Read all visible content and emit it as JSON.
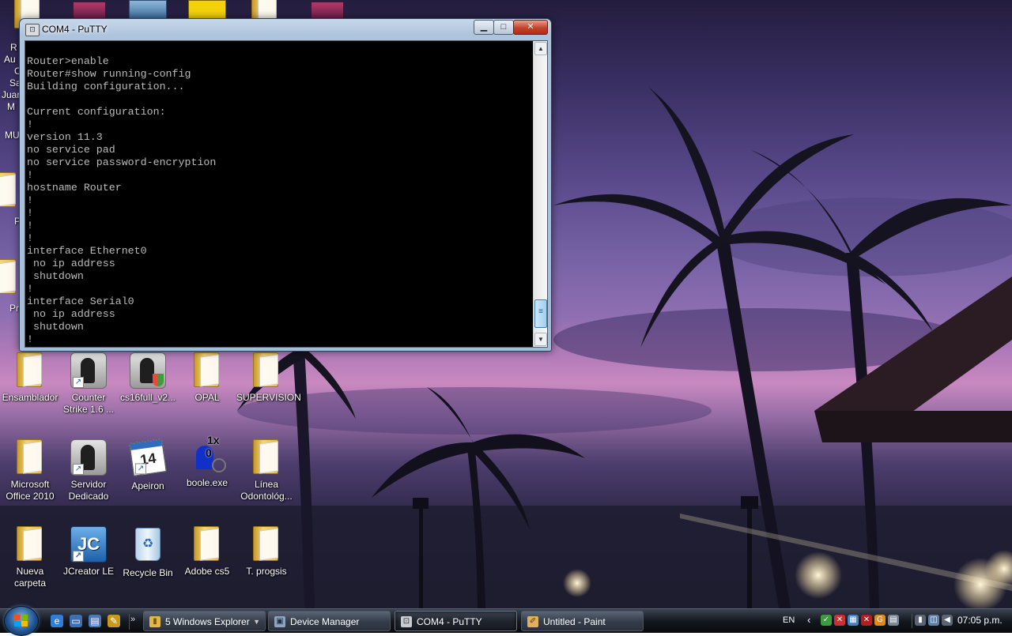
{
  "desktop": {
    "icons": [
      {
        "label": "Ensamblador",
        "type": "folder"
      },
      {
        "label": "Counter Strike 1.6 ...",
        "type": "counter-strike-shortcut"
      },
      {
        "label": "cs16full_v2...",
        "type": "counter-strike-installer"
      },
      {
        "label": "OPAL",
        "type": "folder"
      },
      {
        "label": "SUPERVISION",
        "type": "folder"
      },
      {
        "label": "Microsoft Office 2010",
        "type": "folder"
      },
      {
        "label": "Servidor Dedicado",
        "type": "counter-strike-shortcut"
      },
      {
        "label": "Apeiron",
        "type": "calendar-shortcut"
      },
      {
        "label": "boole.exe",
        "type": "boole-app"
      },
      {
        "label": "Línea Odontológ...",
        "type": "folder"
      },
      {
        "label": "Nueva carpeta",
        "type": "folder"
      },
      {
        "label": "JCreator LE",
        "type": "jcreator-shortcut"
      },
      {
        "label": "Recycle Bin",
        "type": "recycle-bin"
      },
      {
        "label": "Adobe cs5",
        "type": "folder"
      },
      {
        "label": "T. progsis",
        "type": "folder"
      }
    ],
    "left_edge_fragments": [
      "R",
      "Au",
      "C",
      "Sa",
      "Juar",
      "M",
      "MU",
      "P",
      "Pr"
    ]
  },
  "window": {
    "title": "COM4 - PuTTY",
    "controls": {
      "minimize": "▁",
      "maximize": "□",
      "close": "✕"
    },
    "terminal_lines": [
      "Router>enable",
      "Router#show running-config",
      "Building configuration...",
      "",
      "Current configuration:",
      "!",
      "version 11.3",
      "no service pad",
      "no service password-encryption",
      "!",
      "hostname Router",
      "!",
      "!",
      "!",
      "!",
      "interface Ethernet0",
      " no ip address",
      " shutdown",
      "!",
      "interface Serial0",
      " no ip address",
      " shutdown",
      "!"
    ],
    "scrollbar": {
      "up": "▲",
      "down": "▼"
    }
  },
  "taskbar": {
    "quick_launch": [
      {
        "name": "internet-explorer-icon",
        "glyph": "e",
        "color": "#2f7fd6"
      },
      {
        "name": "show-desktop-icon",
        "glyph": "▭",
        "color": "#3f6fb0"
      },
      {
        "name": "switch-windows-icon",
        "glyph": "▤",
        "color": "#4b78b8"
      },
      {
        "name": "pencil-app-icon",
        "glyph": "✎",
        "color": "#c79a1b"
      }
    ],
    "quick_launch_more": "»",
    "tasks": [
      {
        "label": "5 Windows Explorer",
        "icon": "folder-icon",
        "glyph": "▮",
        "icon_color": "#e3b84a",
        "active": false,
        "dropdown": "▼"
      },
      {
        "label": "Device Manager",
        "icon": "device-manager-icon",
        "glyph": "▣",
        "icon_color": "#8fa4bd",
        "active": false
      },
      {
        "label": "COM4 - PuTTY",
        "icon": "putty-icon",
        "glyph": "⊡",
        "icon_color": "#c8ccd2",
        "active": true
      },
      {
        "label": "Untitled - Paint",
        "icon": "paint-icon",
        "glyph": "✐",
        "icon_color": "#e0b060",
        "active": false
      }
    ],
    "language": "EN",
    "tray_chevron": "‹",
    "tray_icons": [
      {
        "name": "safely-remove-icon",
        "glyph": "✓",
        "color": "#3c9b3c"
      },
      {
        "name": "security-alert-icon",
        "glyph": "✕",
        "color": "#c83232"
      },
      {
        "name": "network-icon",
        "glyph": "▦",
        "color": "#4a7fc0"
      },
      {
        "name": "antivirus-icon",
        "glyph": "✕",
        "color": "#b02020"
      },
      {
        "name": "update-icon",
        "glyph": "G",
        "color": "#e08a1e"
      },
      {
        "name": "printer-icon",
        "glyph": "▤",
        "color": "#7a8696"
      },
      {
        "name": "battery-icon",
        "glyph": "▮",
        "color": "#5a6474"
      },
      {
        "name": "wireless-icon",
        "glyph": "◫",
        "color": "#5f7fa8"
      },
      {
        "name": "volume-icon",
        "glyph": "◀",
        "color": "#5a6474"
      }
    ],
    "clock": "07:05 p.m."
  },
  "colors": {
    "terminal_bg": "#000000",
    "terminal_fg": "#bbbbbb",
    "taskbar": "#14181f"
  }
}
